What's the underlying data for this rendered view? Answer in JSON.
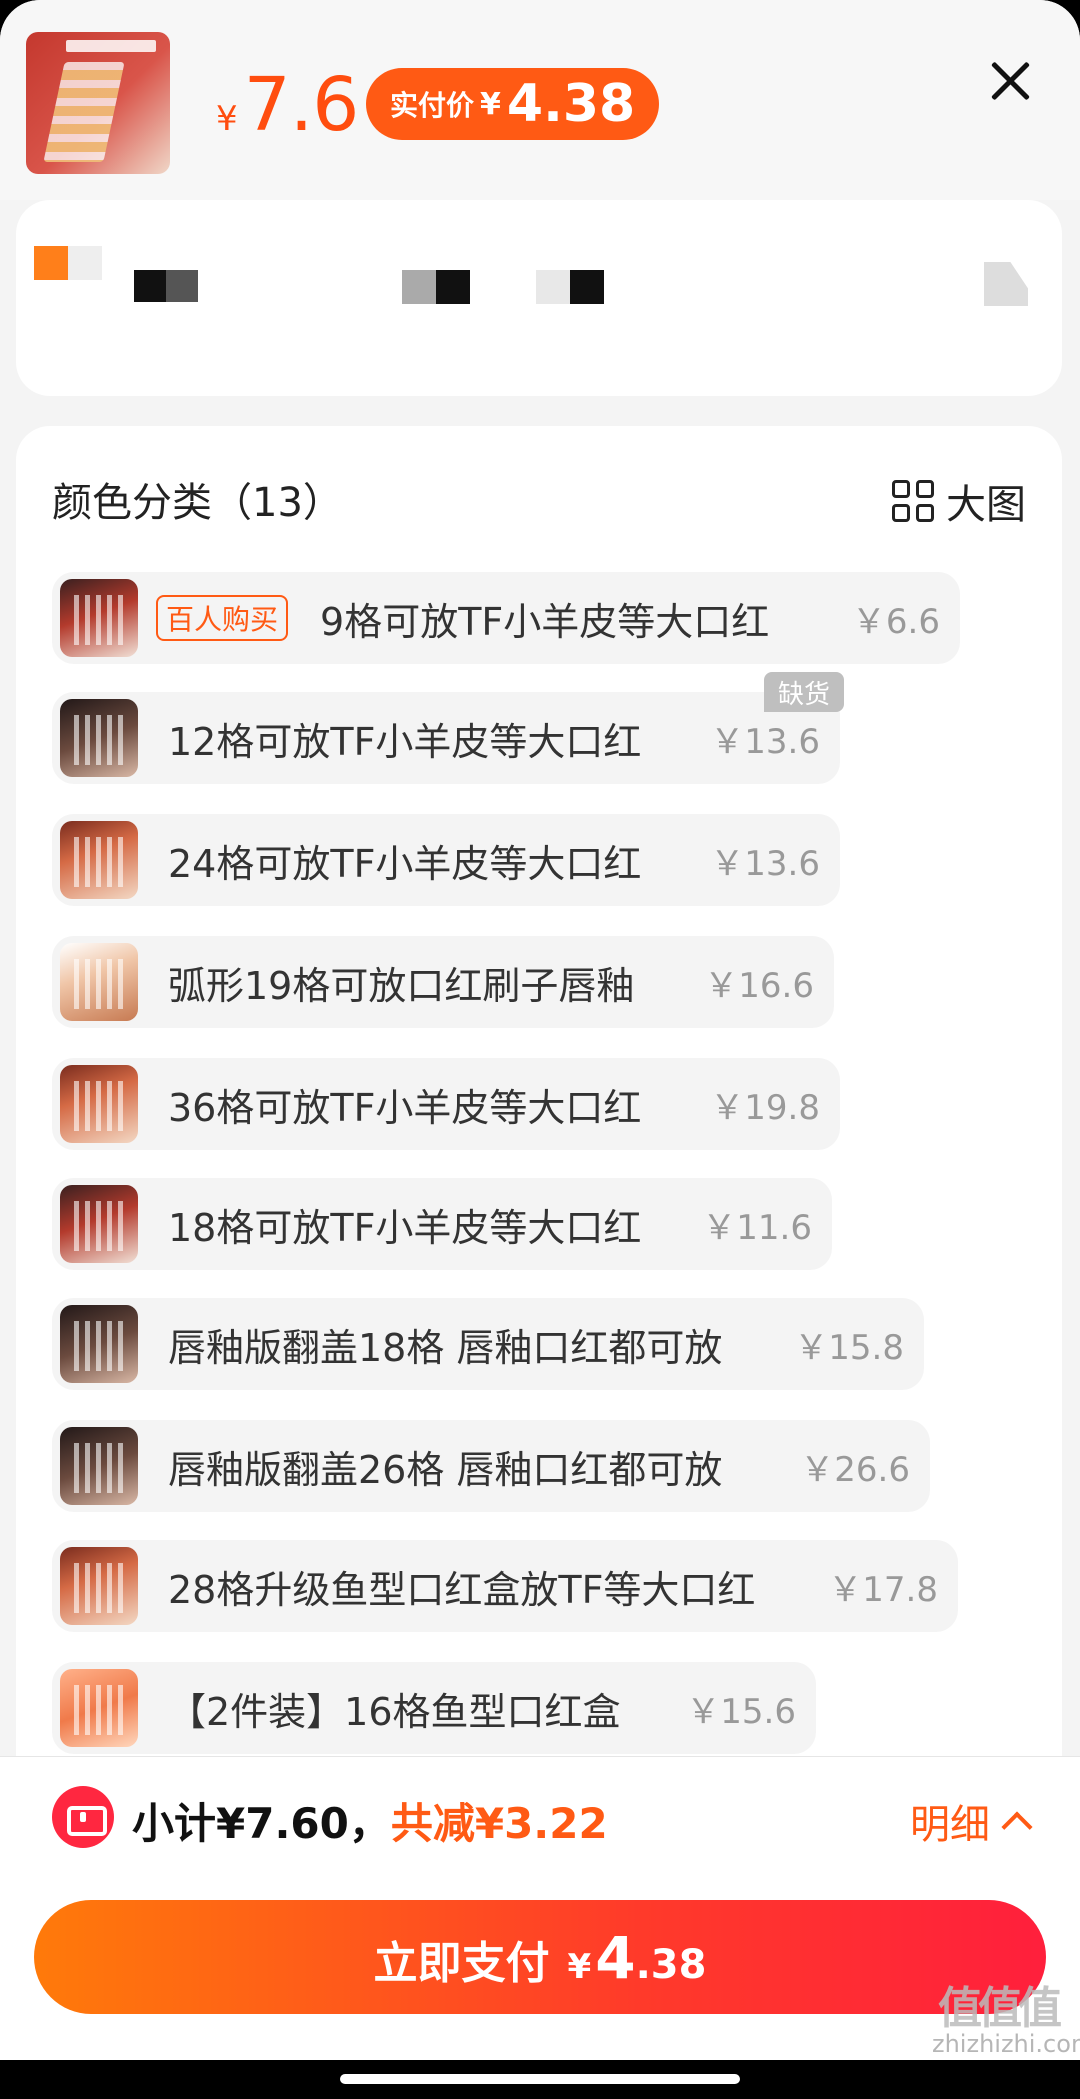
{
  "header": {
    "price_currency": "¥",
    "price": "7.6",
    "real_price_label": "实付价",
    "real_price_currency": "¥",
    "real_price": "4.38"
  },
  "colors": {
    "accent": "#ff5a14",
    "pay_gradient_start": "#ff7a0a",
    "pay_gradient_end": "#ff1f3c",
    "coupon_red": "#ff2740"
  },
  "category": {
    "title": "颜色分类（13）",
    "big_image_label": "大图",
    "out_of_stock_label": "缺货",
    "options": [
      {
        "tag": "百人购买",
        "name": "9格可放TF小羊皮等大口红",
        "price": "￥6.6"
      },
      {
        "name": "12格可放TF小羊皮等大口红",
        "price": "￥13.6"
      },
      {
        "name": "24格可放TF小羊皮等大口红",
        "price": "￥13.6"
      },
      {
        "name": "弧形19格可放口红刷子唇釉",
        "price": "￥16.6"
      },
      {
        "name": "36格可放TF小羊皮等大口红",
        "price": "￥19.8"
      },
      {
        "name": "18格可放TF小羊皮等大口红",
        "price": "￥11.6"
      },
      {
        "name": "唇釉版翻盖18格 唇釉口红都可放",
        "price": "￥15.8"
      },
      {
        "name": "唇釉版翻盖26格 唇釉口红都可放",
        "price": "￥26.6"
      },
      {
        "name": "28格升级鱼型口红盒放TF等大口红",
        "price": "￥17.8"
      },
      {
        "name": "【2件装】16格鱼型口红盒",
        "price": "￥15.6"
      }
    ]
  },
  "footer": {
    "subtotal": "小计¥7.60，",
    "discount": "共减¥3.22",
    "detail_label": "明细",
    "pay_label": "立即支付",
    "pay_currency": "¥",
    "pay_int": "4",
    "pay_dec": ".38"
  },
  "watermark": {
    "big": "值值值",
    "site": "zhizhizhi.com"
  }
}
